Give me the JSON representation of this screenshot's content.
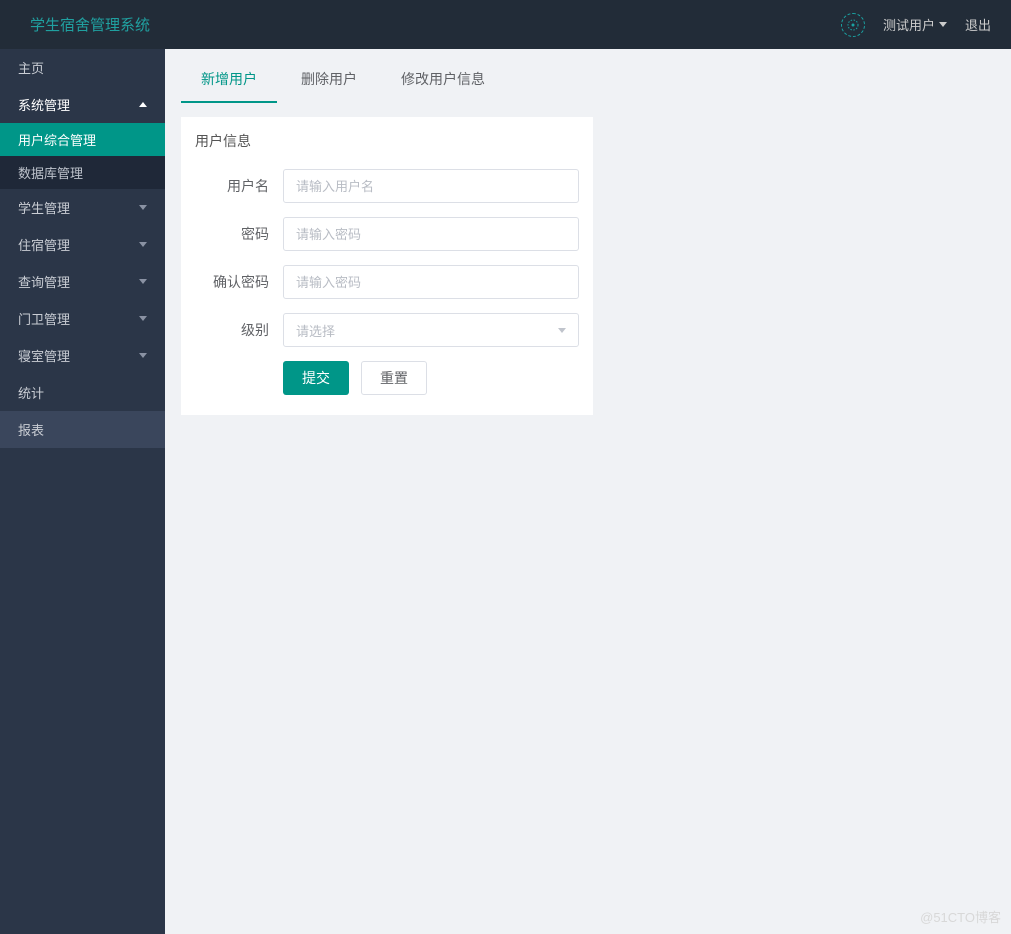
{
  "header": {
    "title": "学生宿舍管理系统",
    "user_name": "测试用户",
    "logout": "退出"
  },
  "sidebar": {
    "items": [
      {
        "label": "主页",
        "type": "item"
      },
      {
        "label": "系统管理",
        "type": "group-open"
      },
      {
        "label": "用户综合管理",
        "type": "sub-active"
      },
      {
        "label": "数据库管理",
        "type": "sub"
      },
      {
        "label": "学生管理",
        "type": "group"
      },
      {
        "label": "住宿管理",
        "type": "group"
      },
      {
        "label": "查询管理",
        "type": "group"
      },
      {
        "label": "门卫管理",
        "type": "group"
      },
      {
        "label": "寝室管理",
        "type": "group"
      },
      {
        "label": "统计",
        "type": "item"
      },
      {
        "label": "报表",
        "type": "item-highlight"
      }
    ]
  },
  "tabs": [
    {
      "label": "新增用户",
      "active": true
    },
    {
      "label": "删除用户",
      "active": false
    },
    {
      "label": "修改用户信息",
      "active": false
    }
  ],
  "form": {
    "title": "用户信息",
    "username_label": "用户名",
    "username_placeholder": "请输入用户名",
    "password_label": "密码",
    "password_placeholder": "请输入密码",
    "confirm_label": "确认密码",
    "confirm_placeholder": "请输入密码",
    "level_label": "级别",
    "level_placeholder": "请选择",
    "submit": "提交",
    "reset": "重置"
  },
  "watermark": "@51CTO博客"
}
